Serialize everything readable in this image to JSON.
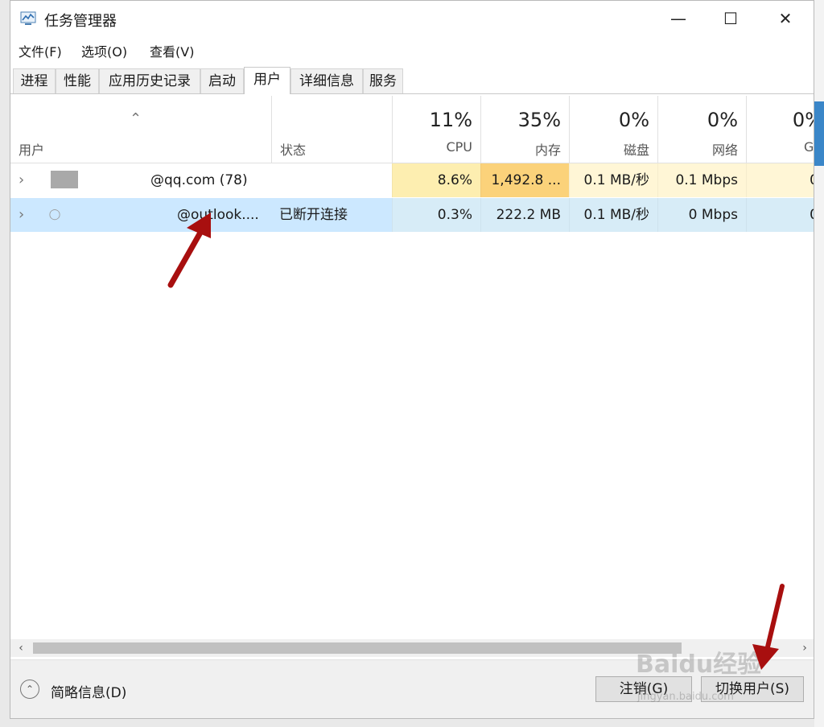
{
  "window": {
    "title": "任务管理器"
  },
  "titlebar": {
    "minimize": "—",
    "maximize": "☐",
    "close": "✕"
  },
  "menu": [
    "文件(F)",
    "选项(O)",
    "查看(V)"
  ],
  "tabs": [
    {
      "label": "进程"
    },
    {
      "label": "性能"
    },
    {
      "label": "应用历史记录"
    },
    {
      "label": "启动"
    },
    {
      "label": "用户"
    },
    {
      "label": "详细信息"
    },
    {
      "label": "服务"
    }
  ],
  "active_tab": "用户",
  "columns": {
    "user": "用户",
    "status": "状态",
    "cpu": {
      "pct": "11%",
      "name": "CPU"
    },
    "memory": {
      "pct": "35%",
      "name": "内存"
    },
    "disk": {
      "pct": "0%",
      "name": "磁盘"
    },
    "network": {
      "pct": "0%",
      "name": "网络"
    },
    "gpu": {
      "pct": "0%",
      "name": "GP"
    }
  },
  "rows": [
    {
      "user": "@qq.com (78)",
      "status": "",
      "cpu": "8.6%",
      "memory": "1,492.8 ...",
      "disk": "0.1 MB/秒",
      "network": "0.1 Mbps",
      "gpu": "0"
    },
    {
      "user": "@outlook....",
      "status": "已断开连接",
      "cpu": "0.3%",
      "memory": "222.2 MB",
      "disk": "0.1 MB/秒",
      "network": "0 Mbps",
      "gpu": "0"
    }
  ],
  "footer": {
    "fewer_details": "简略信息(D)",
    "sign_out": "注销(G)",
    "switch_user": "切换用户(S)"
  },
  "watermark": {
    "text": "Baidu经验",
    "sub": "jingyan.baidu.com"
  },
  "colors": {
    "cpu_high": "#fdeeb0",
    "memory_high": "#fbd27a",
    "cell_low": "#fff6d6",
    "selected_row": "#cce8ff",
    "arrow": "#a80f0f"
  }
}
